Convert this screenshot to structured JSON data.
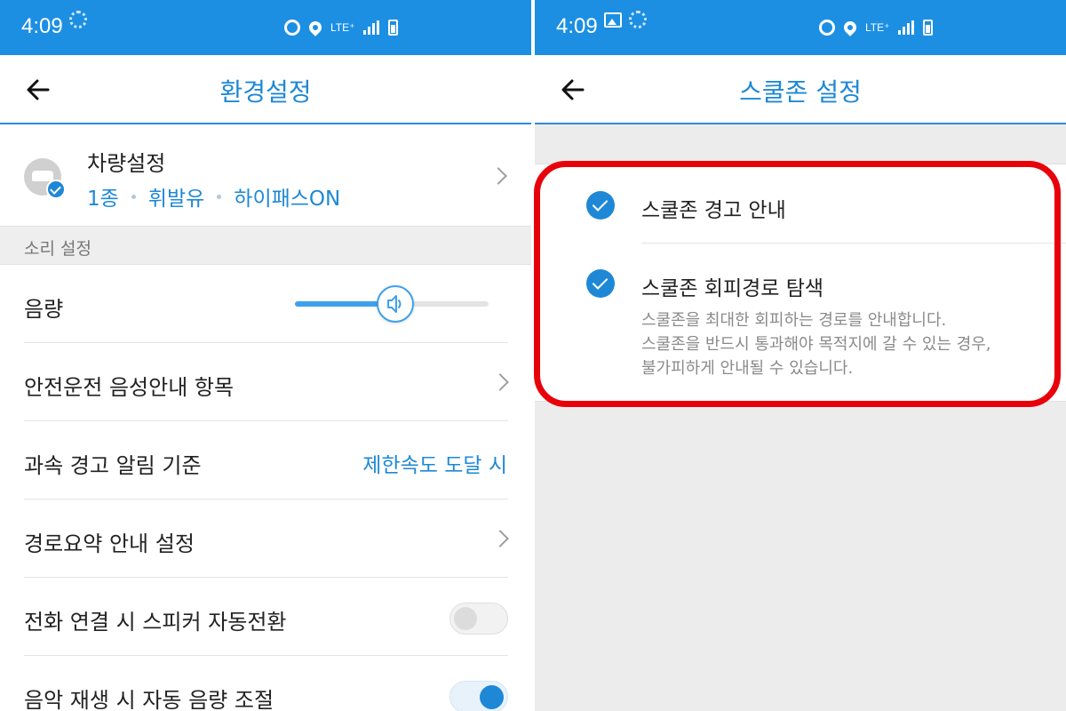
{
  "status_bar": {
    "time": "4:09",
    "network": "LTE⁺"
  },
  "left_screen": {
    "title": "환경설정",
    "vehicle": {
      "name": "차량설정",
      "tags": [
        "1종",
        "휘발유",
        "하이패스ON"
      ]
    },
    "section_header": "소리 설정",
    "volume": {
      "label": "음량",
      "level": 0.52
    },
    "rows": {
      "safety_voice": "안전운전 음성안내 항목",
      "speed_warning": "과속 경고 알림 기준",
      "speed_warning_value": "제한속도 도달 시",
      "route_summary": "경로요약 안내 설정",
      "call_speaker": "전화 연결 시 스피커 자동전환",
      "music_volume": "음악 재생 시 자동 음량 조절"
    },
    "toggles": {
      "call_speaker": false,
      "music_volume": true
    }
  },
  "right_screen": {
    "title": "스쿨존 설정",
    "options": [
      {
        "label": "스쿨존 경고 안내",
        "checked": true
      },
      {
        "label": "스쿨존 회피경로 탐색",
        "checked": true,
        "description": [
          "스쿨존을 최대한 회피하는 경로를 안내합니다.",
          "스쿨존을 반드시 통과해야 목적지에 갈 수 있는 경우,",
          "불가피하게 안내될 수 있습니다."
        ]
      }
    ]
  },
  "colors": {
    "status_bar": "#1c8fe3",
    "accent": "#1e88d6",
    "highlight": "#e8000b"
  }
}
